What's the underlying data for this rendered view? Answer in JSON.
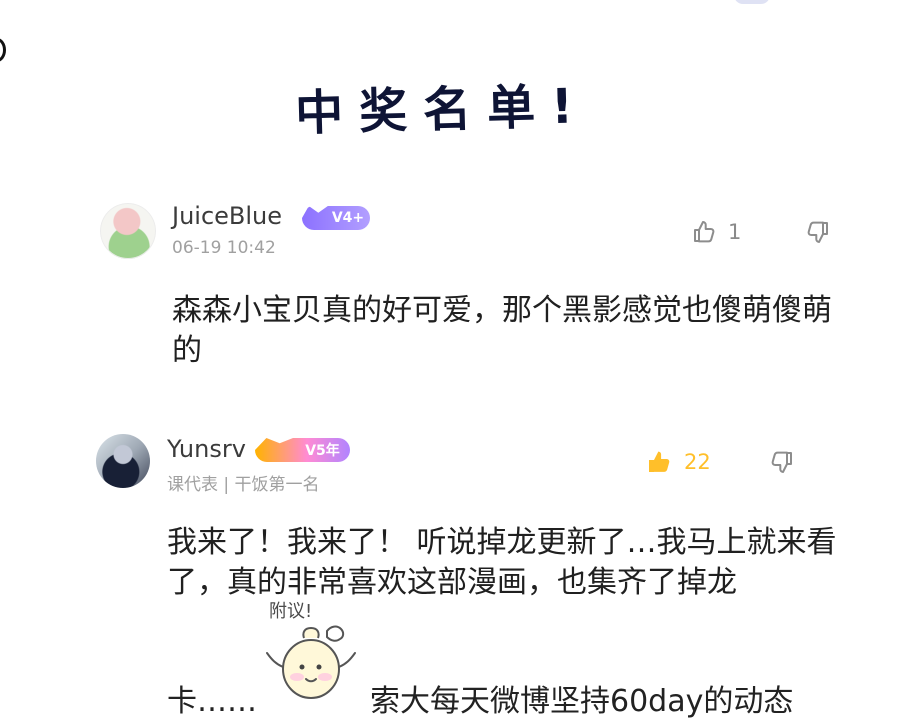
{
  "page": {
    "title": "中奖名单!"
  },
  "comments": [
    {
      "username": "JuiceBlue",
      "badge": "V4+",
      "meta": "06-19 10:42",
      "likes": "1",
      "text": "森森小宝贝真的好可爱，那个黑影感觉也傻萌傻萌的"
    },
    {
      "username": "Yunsrv",
      "badge": "V5年",
      "meta": "课代表 | 干饭第一名",
      "likes": "22",
      "text_main": "我来了！我来了！ 听说掉龙更新了…我马上就来看了，真的非常喜欢这部漫画，也集齐了掉龙",
      "text_tail_left": "卡……",
      "text_tail_right": "索大每天微博坚持60day的动态",
      "sticker_caption": "附议!"
    }
  ],
  "colors": {
    "accent_yellow": "#ffbf2a",
    "text_gray": "#8a8a8a"
  },
  "icons": {
    "like": "thumb-up-icon",
    "dislike": "thumb-down-icon"
  }
}
